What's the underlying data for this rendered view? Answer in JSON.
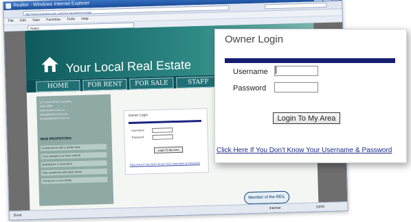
{
  "browser": {
    "title": "Realtor - Windows Internet Explorer",
    "address": "http://www.realestate.com.au/home.aspx#secure-page",
    "menu": [
      "File",
      "Edit",
      "View",
      "Favorites",
      "Tools",
      "Help"
    ],
    "tab_label": "Realtor",
    "status_left": "Done",
    "status_zone": "Internet",
    "zoom": "100%"
  },
  "site": {
    "title": "Your Local Real Estate",
    "nav": [
      "HOME",
      "FOR RENT",
      "FOR SALE",
      "STAFF"
    ],
    "contact": [
      "123 Local Street Localville",
      "1800 0000",
      "www.localrei.com.au",
      "sales@localrei.com.au",
      "rentals@localrei.com.au"
    ],
    "new_properties_heading": "NEW PROPERTIES",
    "new_properties": [
      "Family home with a terrific view",
      "Cute cottage in an inner suburb",
      "Building for a renovation",
      "New apartment with great views",
      "Perfect for a new family"
    ],
    "member_badge": "Member of the REIL"
  },
  "mini_login": {
    "title": "Owner Login",
    "username": "Username",
    "password": "Password",
    "button": "Login To My Area",
    "link": "Click Here If You Don't Know Your Username & Password"
  },
  "login": {
    "title": "Owner Login",
    "username_label": "Username",
    "password_label": "Password",
    "username_value": "",
    "password_value": "",
    "button_label": "Login To My Area",
    "help_link": "Click Here If You Don't Know Your Username & Password"
  },
  "colors": {
    "header_bar": "#151e70",
    "link": "#1b2a8a",
    "banner": "#2f8a86"
  }
}
